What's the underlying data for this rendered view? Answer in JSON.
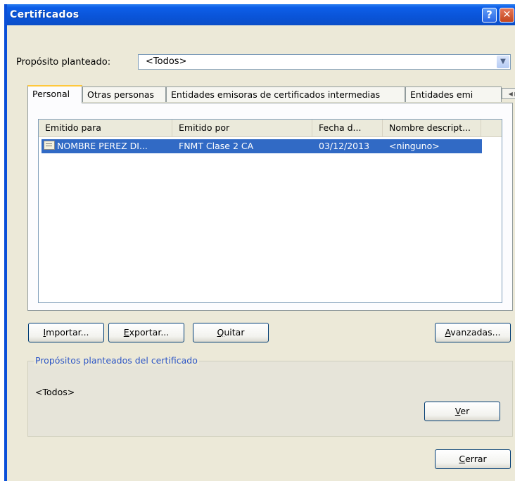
{
  "window": {
    "title": "Certificados",
    "help_glyph": "?",
    "close_glyph": "✕"
  },
  "purpose": {
    "label": "Propósito planteado:",
    "value": "<Todos>"
  },
  "tabs": [
    {
      "label": "Personal",
      "active": true
    },
    {
      "label": "Otras personas"
    },
    {
      "label": "Entidades emisoras de certificados intermedias"
    },
    {
      "label": "Entidades emi"
    }
  ],
  "tab_scroll": {
    "left": "◀",
    "right": "▶"
  },
  "list": {
    "columns": [
      "Emitido para",
      "Emitido por",
      "Fecha d...",
      "Nombre descript..."
    ],
    "rows": [
      {
        "issued_to": "NOMBRE PEREZ DI...",
        "issued_by": "FNMT Clase 2 CA",
        "date": "03/12/2013",
        "friendly_name": "<ninguno>",
        "selected": true
      }
    ]
  },
  "buttons": {
    "import": {
      "key": "I",
      "rest": "mportar..."
    },
    "export": {
      "key": "E",
      "rest": "xportar..."
    },
    "remove": {
      "key": "Q",
      "rest": "uitar"
    },
    "advanced": {
      "key": "A",
      "rest": "vanzadas..."
    },
    "view": {
      "key": "V",
      "rest": "er"
    },
    "close": {
      "key": "C",
      "rest": "errar"
    }
  },
  "purposes_group": {
    "title": "Propósitos planteados del certificado",
    "value": "<Todos>"
  },
  "colors": {
    "titlebar": "#0a54d8",
    "selection": "#316ac5",
    "group_title": "#2d56c6",
    "dialog_bg": "#ece9d8"
  }
}
